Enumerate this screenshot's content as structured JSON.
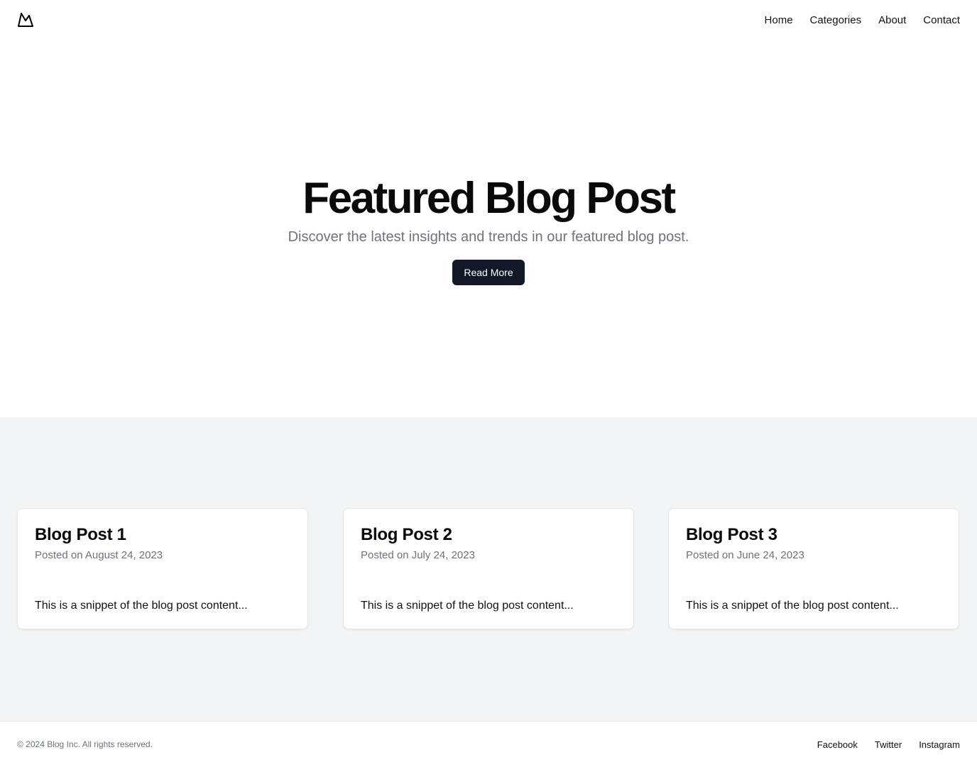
{
  "header": {
    "logo_icon": "mountain-icon",
    "nav": [
      {
        "label": "Home"
      },
      {
        "label": "Categories"
      },
      {
        "label": "About"
      },
      {
        "label": "Contact"
      }
    ]
  },
  "hero": {
    "title": "Featured Blog Post",
    "subtitle": "Discover the latest insights and trends in our featured blog post.",
    "button_label": "Read More"
  },
  "posts": [
    {
      "title": "Blog Post 1",
      "date": "Posted on August 24, 2023",
      "snippet": "This is a snippet of the blog post content..."
    },
    {
      "title": "Blog Post 2",
      "date": "Posted on July 24, 2023",
      "snippet": "This is a snippet of the blog post content..."
    },
    {
      "title": "Blog Post 3",
      "date": "Posted on June 24, 2023",
      "snippet": "This is a snippet of the blog post content..."
    }
  ],
  "footer": {
    "copyright": "© 2024 Blog Inc. All rights reserved.",
    "links": [
      {
        "label": "Facebook"
      },
      {
        "label": "Twitter"
      },
      {
        "label": "Instagram"
      }
    ]
  },
  "colors": {
    "button_bg": "#111827",
    "section_bg": "#f3f4f6",
    "muted_text": "#6b7280"
  }
}
